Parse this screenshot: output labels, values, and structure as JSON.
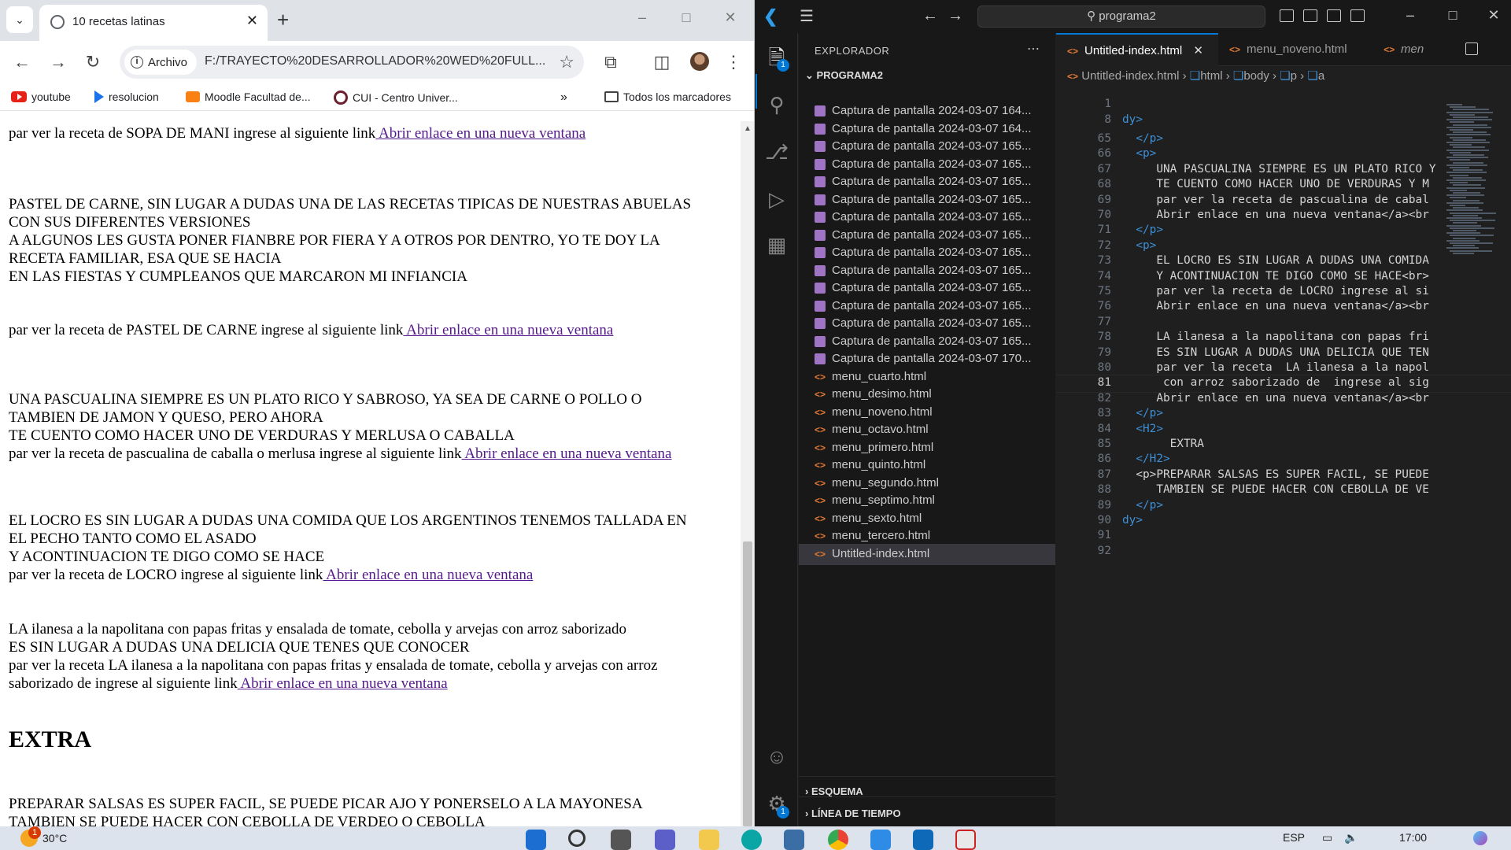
{
  "chrome": {
    "tab_title": "10 recetas latinas",
    "address_chip": "Archivo",
    "url": "F:/TRAYECTO%20DESARROLLADOR%20WED%20FULL...",
    "bookmarks": [
      "youtube",
      "resolucion",
      "Moodle Facultad de...",
      "CUI - Centro Univer..."
    ],
    "all_bookmarks": "Todos los marcadores",
    "page": {
      "para1_line1": "par ver la receta de SOPA DE MANI ingrese al siguiente link",
      "link_text": " Abrir enlace en una nueva ventana",
      "para2_line1": "PASTEL DE CARNE, SIN LUGAR A DUDAS UNA DE LAS RECETAS TIPICAS DE NUESTRAS ABUELAS",
      "para2_line2": "CON SUS DIFERENTES VERSIONES",
      "para2_line3": "A ALGUNOS LES GUSTA PONER FIANBRE POR FIERA Y A OTROS POR DENTRO, YO TE DOY LA",
      "para2_line4": "RECETA FAMILIAR, ESA QUE SE HACIA",
      "para2_line5": "EN LAS FIESTAS Y CUMPLEANOS QUE MARCARON MI INFIANCIA",
      "para2_link_line": "par ver la receta de PASTEL DE CARNE ingrese al siguiente link",
      "para3_line1": "UNA PASCUALINA SIEMPRE ES UN PLATO RICO Y SABROSO, YA SEA DE CARNE O POLLO O",
      "para3_line2": "TAMBIEN DE JAMON Y QUESO, PERO AHORA",
      "para3_line3": "TE CUENTO COMO HACER UNO DE VERDURAS Y MERLUSA O CABALLA",
      "para3_link_line": "par ver la receta de pascualina de caballa o merlusa ingrese al siguiente link",
      "para4_line1": "EL LOCRO ES SIN LUGAR A DUDAS UNA COMIDA QUE LOS ARGENTINOS TENEMOS TALLADA EN",
      "para4_line2": "EL PECHO TANTO COMO EL ASADO",
      "para4_line3": "Y ACONTINUACION TE DIGO COMO SE HACE",
      "para4_link_line": "par ver la receta de LOCRO ingrese al siguiente link",
      "para5_line1": "LA ilanesa a la napolitana con papas fritas y ensalada de tomate, cebolla y arvejas con arroz saborizado",
      "para5_line2": "ES SIN LUGAR A DUDAS UNA DELICIA QUE TENES QUE CONOCER",
      "para5_line3": "par ver la receta LA ilanesa a la napolitana con papas fritas y ensalada de tomate, cebolla y arvejas con arroz",
      "para5_link_line": "saborizado de ingrese al siguiente link",
      "heading": "EXTRA",
      "para6_line1": "PREPARAR SALSAS ES SUPER FACIL, SE PUEDE PICAR AJO Y PONERSELO A LA MAYONESA",
      "para6_line2": "TAMBIEN SE PUEDE HACER CON CEBOLLA DE VERDEO O CEBOLLA"
    }
  },
  "vscode": {
    "search": "programa2",
    "explorer_title": "EXPLORADOR",
    "folder": "PROGRAMA2",
    "files": [
      "Captura de pantalla 2024-03-07 164...",
      "Captura de pantalla 2024-03-07 164...",
      "Captura de pantalla 2024-03-07 165...",
      "Captura de pantalla 2024-03-07 165...",
      "Captura de pantalla 2024-03-07 165...",
      "Captura de pantalla 2024-03-07 165...",
      "Captura de pantalla 2024-03-07 165...",
      "Captura de pantalla 2024-03-07 165...",
      "Captura de pantalla 2024-03-07 165...",
      "Captura de pantalla 2024-03-07 165...",
      "Captura de pantalla 2024-03-07 165...",
      "Captura de pantalla 2024-03-07 165...",
      "Captura de pantalla 2024-03-07 165...",
      "Captura de pantalla 2024-03-07 165...",
      "Captura de pantalla 2024-03-07 170...",
      "menu_cuarto.html",
      "menu_desimo.html",
      "menu_noveno.html",
      "menu_octavo.html",
      "menu_primero.html",
      "menu_quinto.html",
      "menu_segundo.html",
      "menu_septimo.html",
      "menu_sexto.html",
      "menu_tercero.html",
      "Untitled-index.html"
    ],
    "outline": "ESQUEMA",
    "timeline": "LÍNEA DE TIEMPO",
    "tabs": [
      "Untitled-index.html",
      "menu_noveno.html",
      "men"
    ],
    "breadcrumbs": [
      "Untitled-index.html",
      "html",
      "body",
      "p",
      "a"
    ],
    "code": [
      {
        "n": "1",
        "t": ""
      },
      {
        "n": "8",
        "t": "dy>"
      },
      {
        "n": "65",
        "t": "  </p>"
      },
      {
        "n": "66",
        "t": "  <p>"
      },
      {
        "n": "67",
        "t": "     UNA PASCUALINA SIEMPRE ES UN PLATO RICO Y"
      },
      {
        "n": "68",
        "t": "     TE CUENTO COMO HACER UNO DE VERDURAS Y M"
      },
      {
        "n": "69",
        "t": "     par ver la receta de pascualina de cabal"
      },
      {
        "n": "70",
        "t": "     Abrir enlace en una nueva ventana</a><br"
      },
      {
        "n": "71",
        "t": "  </p>"
      },
      {
        "n": "72",
        "t": "  <p>"
      },
      {
        "n": "73",
        "t": "     EL LOCRO ES SIN LUGAR A DUDAS UNA COMIDA"
      },
      {
        "n": "74",
        "t": "     Y ACONTINUACION TE DIGO COMO SE HACE<br>"
      },
      {
        "n": "75",
        "t": "     par ver la receta de LOCRO ingrese al si"
      },
      {
        "n": "76",
        "t": "     Abrir enlace en una nueva ventana</a><br"
      },
      {
        "n": "77",
        "t": ""
      },
      {
        "n": "78",
        "t": "     LA ilanesa a la napolitana con papas fri"
      },
      {
        "n": "79",
        "t": "     ES SIN LUGAR A DUDAS UNA DELICIA QUE TEN"
      },
      {
        "n": "80",
        "t": "     par ver la receta  LA ilanesa a la napol"
      },
      {
        "n": "81",
        "t": "      con arroz saborizado de  ingrese al sig"
      },
      {
        "n": "82",
        "t": "     Abrir enlace en una nueva ventana</a><br"
      },
      {
        "n": "83",
        "t": "  </p>"
      },
      {
        "n": "84",
        "t": "  <H2>"
      },
      {
        "n": "85",
        "t": "       EXTRA"
      },
      {
        "n": "86",
        "t": "  </H2>"
      },
      {
        "n": "87",
        "t": "  <p>PREPARAR SALSAS ES SUPER FACIL, SE PUEDE"
      },
      {
        "n": "88",
        "t": "     TAMBIEN SE PUEDE HACER CON CEBOLLA DE VE"
      },
      {
        "n": "89",
        "t": "  </p>"
      },
      {
        "n": "90",
        "t": "dy>"
      },
      {
        "n": "91",
        "t": ""
      },
      {
        "n": "92",
        "t": ""
      }
    ]
  },
  "taskbar": {
    "temperature": "30°C",
    "weather_badge": "1",
    "language": "ESP",
    "time": "17:00"
  },
  "badges": {
    "explorer": "1",
    "settings": "1"
  }
}
